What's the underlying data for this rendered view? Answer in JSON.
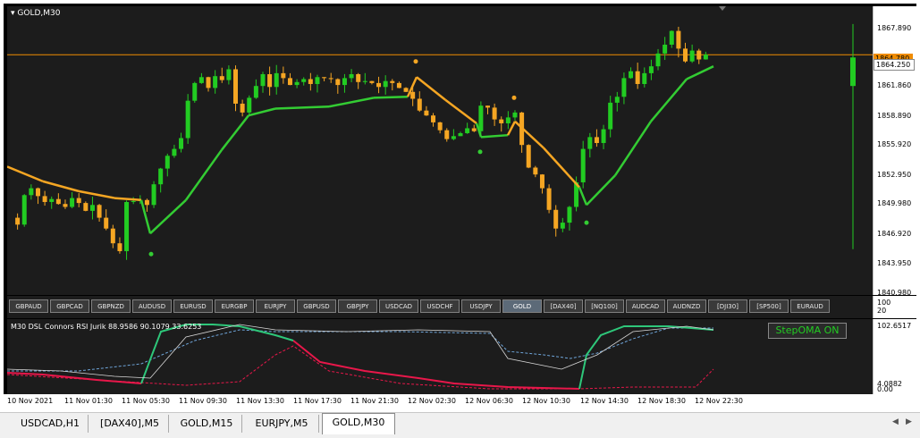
{
  "window": {
    "title": "GOLD,M30",
    "symbol_title": "GOLD,M30"
  },
  "price_axis": {
    "labels": [
      "1867.890",
      "1864.890",
      "1861.860",
      "1858.890",
      "1855.920",
      "1852.950",
      "1849.980",
      "1846.920",
      "1843.950",
      "1840.980"
    ],
    "tag_orange": "1864.780",
    "tag_current": "1864.250"
  },
  "strip_axis": {
    "top": "100",
    "bottom": "20"
  },
  "symbol_buttons": [
    "GBPAUD",
    "GBPCAD",
    "GBPNZD",
    "AUDUSD",
    "EURUSD",
    "EURGBP",
    "EURJPY",
    "GBPUSD",
    "GBPJPY",
    "USDCAD",
    "USDCHF",
    "USDJPY",
    "GOLD",
    "[DAX40]",
    "[NQ100]",
    "AUDCAD",
    "AUDNZD",
    "[DJI30]",
    "[SP500]",
    "EURAUD"
  ],
  "active_symbol": "GOLD",
  "indicator": {
    "title": "M30 DSL Connors RSI Jurik 88.9586 90.1079 33.6253",
    "button": "StepOMA ON",
    "axis_top": "102.6517",
    "axis_mid": "4.0882",
    "axis_bottom": "0.00"
  },
  "time_axis": [
    "10 Nov 2021",
    "11 Nov 01:30",
    "11 Nov 05:30",
    "11 Nov 09:30",
    "11 Nov 13:30",
    "11 Nov 17:30",
    "11 Nov 21:30",
    "12 Nov 02:30",
    "12 Nov 06:30",
    "12 Nov 10:30",
    "12 Nov 14:30",
    "12 Nov 18:30",
    "12 Nov 22:30"
  ],
  "tabs": [
    "USDCAD,H1",
    "[DAX40],M5",
    "GOLD,M15",
    "EURJPY,M5",
    "GOLD,M30"
  ],
  "active_tab": "GOLD,M30",
  "colors": {
    "bull": "#22cc22",
    "bear": "#f5a623",
    "oma_green": "#33cc33",
    "oma_orange": "#f5a623",
    "rsi_red": "#e8174a",
    "rsi_green": "#2ec77a",
    "blue_dash": "#6ea4d8",
    "orange_line": "#f08c00"
  }
}
